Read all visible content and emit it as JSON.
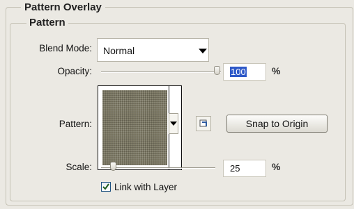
{
  "panel": {
    "group_title": "Pattern Overlay",
    "subgroup_title": "Pattern"
  },
  "blend_mode": {
    "label": "Blend Mode:",
    "value": "Normal"
  },
  "opacity": {
    "label": "Opacity:",
    "value": "100",
    "unit": "%",
    "level": 1.0
  },
  "pattern": {
    "label": "Pattern:",
    "snap_button": "Snap to Origin",
    "swatch_color": "#7c7863"
  },
  "scale": {
    "label": "Scale:",
    "value": "25",
    "unit": "%"
  },
  "link_with_layer": {
    "label": "Link with Layer",
    "checked": true
  },
  "colors": {
    "background": "#ebe9e3",
    "selection": "#2e59c8"
  }
}
